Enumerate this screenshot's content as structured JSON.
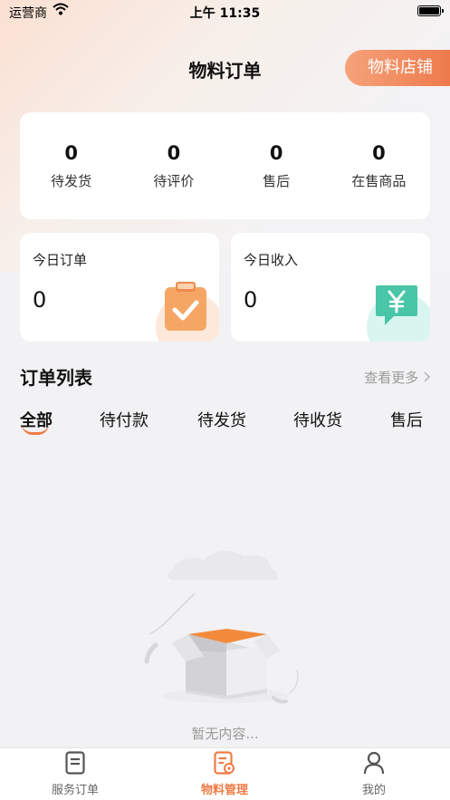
{
  "status_bar": {
    "carrier": "运营商",
    "time": "上午 11:35"
  },
  "header": {
    "title": "物料订单",
    "store_button": "物料店铺"
  },
  "stats": [
    {
      "value": "0",
      "label": "待发货"
    },
    {
      "value": "0",
      "label": "待评价"
    },
    {
      "value": "0",
      "label": "售后"
    },
    {
      "value": "0",
      "label": "在售商品"
    }
  ],
  "today_orders": {
    "title": "今日订单",
    "value": "0",
    "icon": "clipboard-check-icon"
  },
  "today_income": {
    "title": "今日收入",
    "value": "0",
    "icon": "yen-chat-icon"
  },
  "order_list": {
    "title": "订单列表",
    "more": "查看更多",
    "tabs": [
      "全部",
      "待付款",
      "待发货",
      "待收货",
      "售后"
    ],
    "active_tab": "全部",
    "empty_text": "暂无内容..."
  },
  "bottom_nav": [
    {
      "label": "服务订单",
      "icon": "document-icon"
    },
    {
      "label": "物料管理",
      "icon": "material-manage-icon"
    },
    {
      "label": "我的",
      "icon": "person-icon"
    }
  ],
  "colors": {
    "accent": "#ef7b44",
    "green": "#48c6a7",
    "background": "#f2f2f4"
  }
}
